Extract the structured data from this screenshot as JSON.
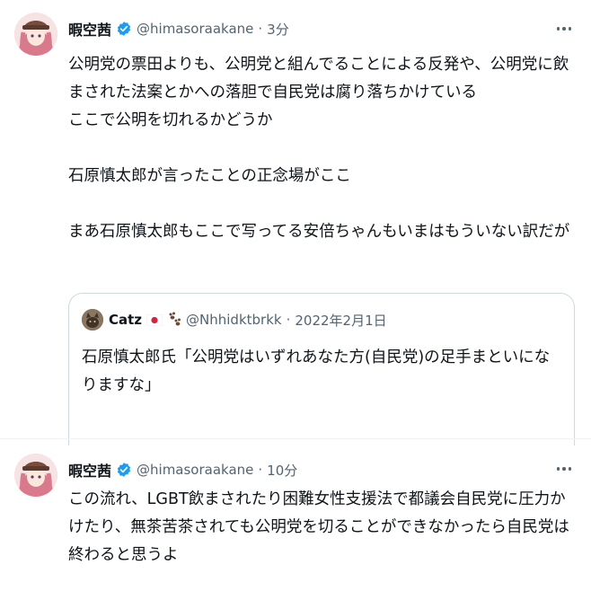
{
  "tweets": [
    {
      "display_name": "暇空茜",
      "handle": "@himasoraakane",
      "separator": "·",
      "time": "3分",
      "text": "公明党の票田よりも、公明党と組んでることによる反発や、公明党に飲まされた法案とかへの落胆で自民党は腐り落ちかけている\nここで公明を切れるかどうか\n\n石原慎太郎が言ったことの正念場がここ\n\nまあ石原慎太郎もここで写ってる安倍ちゃんもいまはもういない訳だが",
      "quote": {
        "display_name": "Catz",
        "flag_icon": "japan-flag-icon",
        "paw_icon": "paw-prints-icon",
        "handle": "@Nhhidktbrkk",
        "separator": "·",
        "time": "2022年2月1日",
        "text": "石原慎太郎氏「公明党はいずれあなた方(自民党)の足手まといになりますな」"
      }
    },
    {
      "display_name": "暇空茜",
      "handle": "@himasoraakane",
      "separator": "·",
      "time": "10分",
      "text": "この流れ、LGBT飲まされたり困難女性支援法で都議会自民党に圧力かけたり、無茶苦茶されても公明党を切ることができなかったら自民党は終わると思うよ"
    }
  ],
  "colors": {
    "text": "#0f1419",
    "muted": "#536471",
    "verified": "#1d9bf0",
    "border": "#cfd9de"
  },
  "icons": {
    "verified": "verified-badge-icon",
    "more": "more-options-icon"
  }
}
